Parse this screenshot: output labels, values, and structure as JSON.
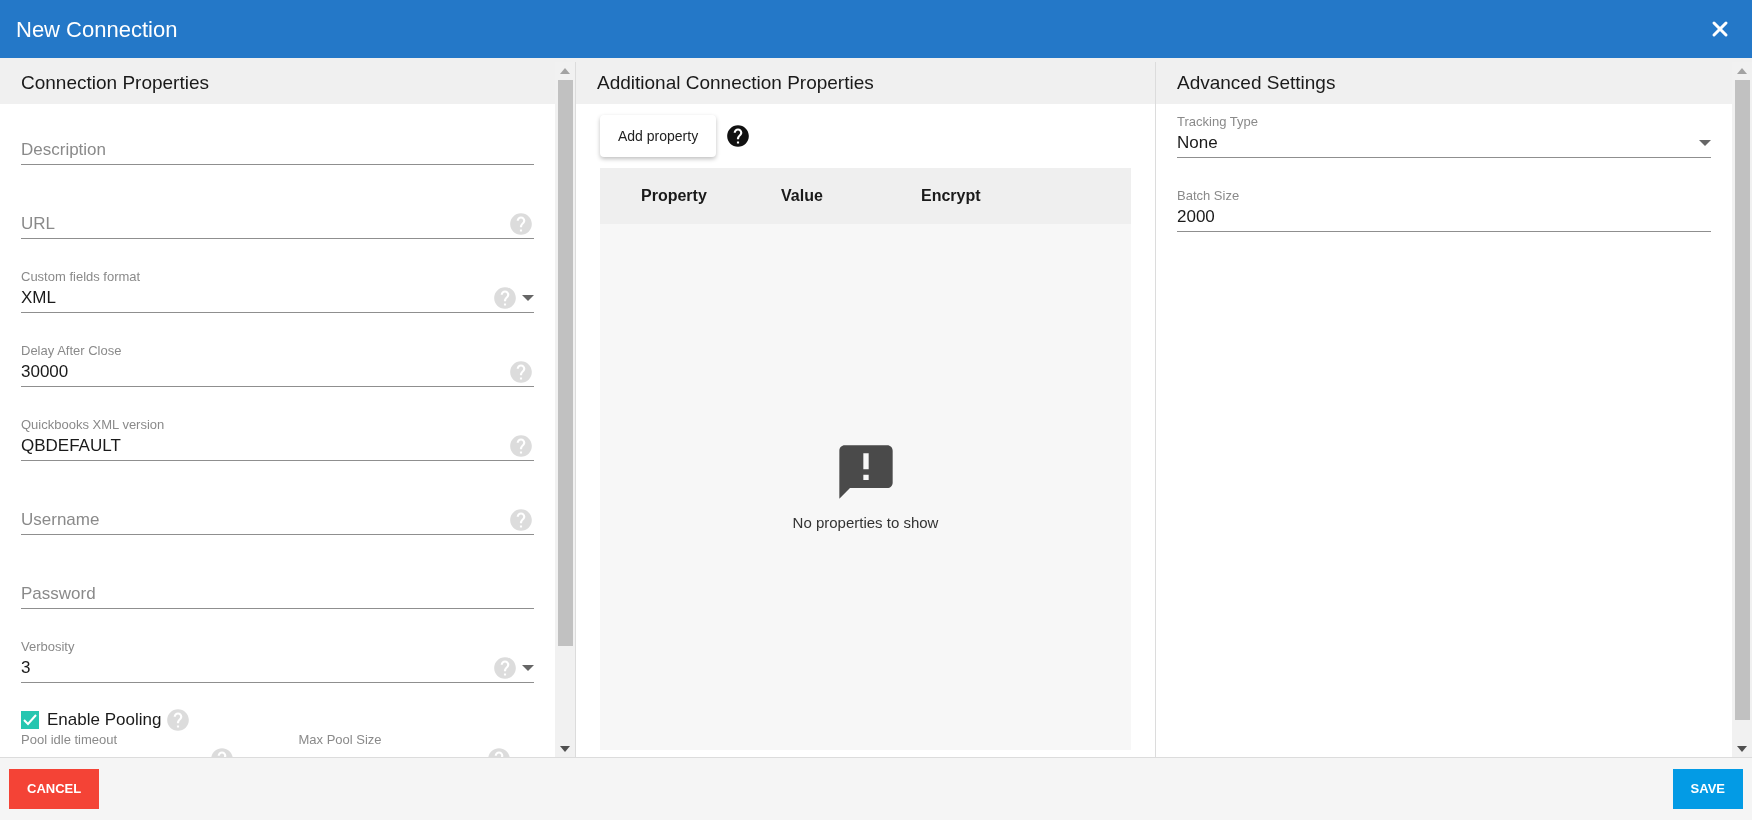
{
  "window": {
    "title": "New Connection"
  },
  "connection_properties": {
    "title": "Connection Properties",
    "fields": [
      {
        "placeholder": "Description",
        "help": false,
        "dropdown": false
      },
      {
        "placeholder": "URL",
        "help": true,
        "dropdown": false
      },
      {
        "label": "Custom fields format",
        "value": "XML",
        "help": true,
        "dropdown": true
      },
      {
        "label": "Delay After Close",
        "value": "30000",
        "help": true,
        "dropdown": false
      },
      {
        "label": "Quickbooks XML version",
        "value": "QBDEFAULT",
        "help": true,
        "dropdown": false
      },
      {
        "placeholder": "Username",
        "help": true,
        "dropdown": false
      },
      {
        "placeholder": "Password",
        "help": false,
        "dropdown": false
      },
      {
        "label": "Verbosity",
        "value": "3",
        "help": true,
        "dropdown": true
      }
    ],
    "enable_pooling": {
      "label": "Enable Pooling",
      "checked": true,
      "help": true
    },
    "pool_fields": [
      {
        "label": "Pool idle timeout",
        "help": true
      },
      {
        "label": "Max Pool Size",
        "help": true
      }
    ]
  },
  "additional_properties": {
    "title": "Additional Connection Properties",
    "add_button": "Add property",
    "table": {
      "columns": [
        "Property",
        "Value",
        "Encrypt"
      ],
      "empty_message": "No properties to show"
    }
  },
  "advanced_settings": {
    "title": "Advanced Settings",
    "fields": [
      {
        "label": "Tracking Type",
        "value": "None",
        "help": false,
        "dropdown": true
      },
      {
        "label": "Batch Size",
        "value": "2000",
        "help": false,
        "dropdown": false
      }
    ]
  },
  "buttons": {
    "cancel": "CANCEL",
    "save": "SAVE"
  }
}
